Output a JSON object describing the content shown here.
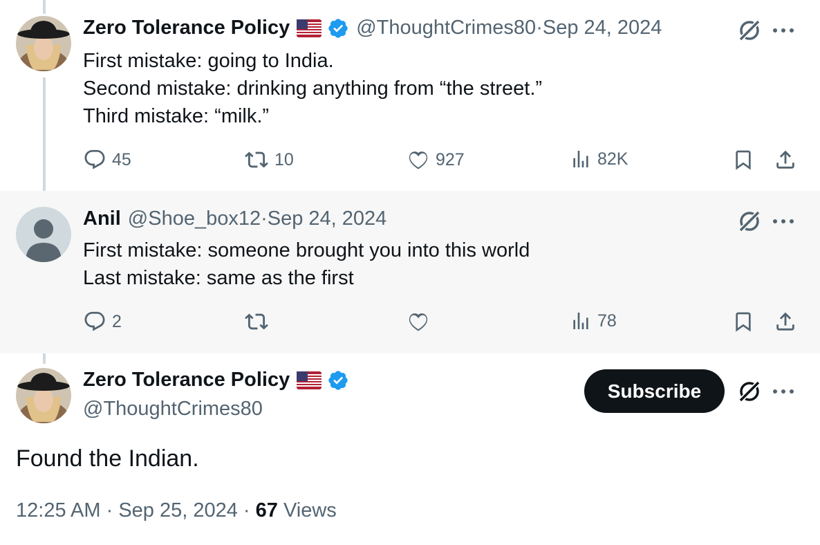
{
  "tweets": [
    {
      "name": "Zero Tolerance Policy",
      "handle": "@ThoughtCrimes80",
      "dot": " · ",
      "date": "Sep 24, 2024",
      "text": "First mistake: going to India.\nSecond mistake: drinking anything from “the street.”\nThird mistake: “milk.”",
      "replies": "45",
      "retweets": "10",
      "likes": "927",
      "views": "82K"
    },
    {
      "name": "Anil",
      "handle": "@Shoe_box12",
      "dot": " · ",
      "date": "Sep 24, 2024",
      "text": "First mistake: someone brought you into this world\nLast mistake: same as the first",
      "replies": "2",
      "retweets": "",
      "likes": "",
      "views": "78"
    }
  ],
  "main": {
    "name": "Zero Tolerance Policy",
    "handle": "@ThoughtCrimes80",
    "subscribe_label": "Subscribe",
    "text": "Found the Indian.",
    "time": "12:25 AM",
    "dot1": " · ",
    "date": "Sep 25, 2024",
    "dot2": " · ",
    "views_count": "67",
    "views_label": " Views"
  },
  "icons": [
    "us-flag-icon",
    "verified-badge-icon",
    "grok-icon",
    "more-icon",
    "reply-icon",
    "retweet-icon",
    "like-icon",
    "views-icon",
    "bookmark-icon",
    "share-icon"
  ],
  "colors": {
    "verified": "#1d9bf0",
    "text": "#0f1419",
    "secondary": "#536471",
    "thread": "#cfd9de",
    "highlight_bg": "#f7f7f7"
  }
}
